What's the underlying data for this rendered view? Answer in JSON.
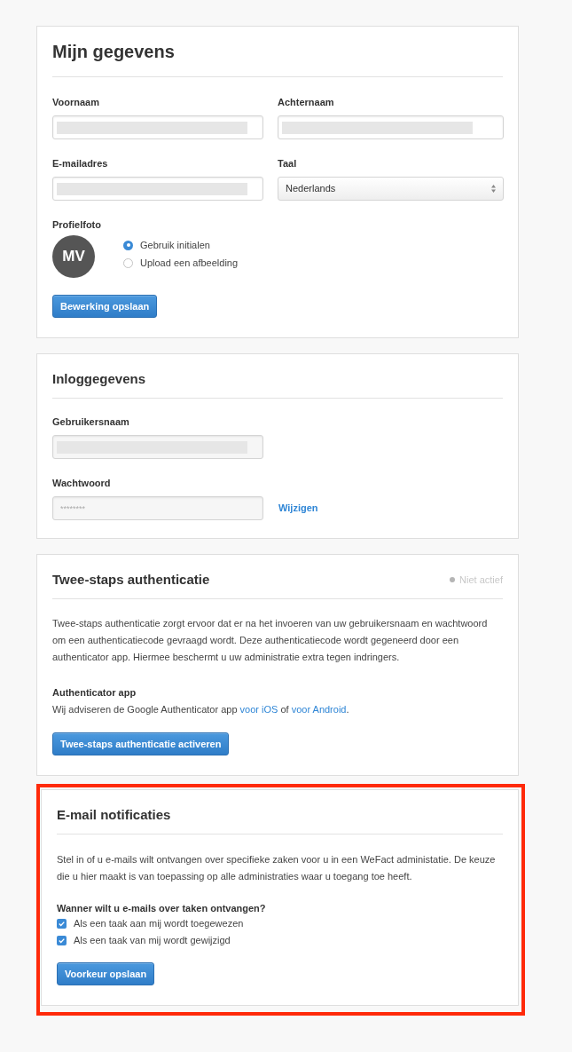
{
  "sections": [
    {
      "kind": "profile",
      "title": "Mijn gegevens",
      "highlighted": false,
      "fields": [
        {
          "label": "Voornaam",
          "kind": "text",
          "redacted": true
        },
        {
          "label": "Achternaam",
          "kind": "text",
          "redacted": true
        },
        {
          "label": "E-mailadres",
          "kind": "text",
          "redacted": true
        },
        {
          "label": "Taal",
          "kind": "select",
          "value": "Nederlands"
        }
      ],
      "photo": {
        "label": "Profielfoto",
        "initials": "MV",
        "options": [
          {
            "label": "Gebruik initialen",
            "selected": true
          },
          {
            "label": "Upload een afbeelding",
            "selected": false
          }
        ]
      },
      "button": "Bewerking opslaan"
    },
    {
      "kind": "login",
      "title": "Inloggegevens",
      "highlighted": false,
      "fields": [
        {
          "label": "Gebruikersnaam",
          "kind": "readonly",
          "redacted": true
        },
        {
          "label": "Wachtwoord",
          "kind": "password",
          "placeholder": "********",
          "link": "Wijzigen"
        }
      ]
    },
    {
      "kind": "two_factor",
      "title": "Twee-staps authenticatie",
      "highlighted": false,
      "status": {
        "label": "Niet actief",
        "active": false
      },
      "description": "Twee-staps authenticatie zorgt ervoor dat er na het invoeren van uw gebruikersnaam en wachtwoord om een authenticatiecode gevraagd wordt. Deze authenticatiecode wordt gegeneerd door een authenticator app. Hiermee beschermt u uw administratie extra tegen indringers.",
      "subheading": "Authenticator app",
      "recommendation": {
        "text": "Wij adviseren de Google Authenticator app",
        "link_ios": "voor iOS",
        "joiner": "of",
        "link_android": "voor Android",
        "end": "."
      },
      "button": "Twee-staps authenticatie activeren"
    },
    {
      "kind": "notifications",
      "title": "E-mail notificaties",
      "highlighted": true,
      "description": "Stel in of u e-mails wilt ontvangen over specifieke zaken voor u in een WeFact administatie. De keuze die u hier maakt is van toepassing op alle administraties waar u toegang toe heeft.",
      "question": "Wanner wilt u e-mails over taken ontvangen?",
      "options": [
        {
          "label": "Als een taak aan mij wordt toegewezen",
          "checked": true
        },
        {
          "label": "Als een taak van mij wordt gewijzigd",
          "checked": true
        }
      ],
      "button": "Voorkeur opslaan"
    }
  ]
}
